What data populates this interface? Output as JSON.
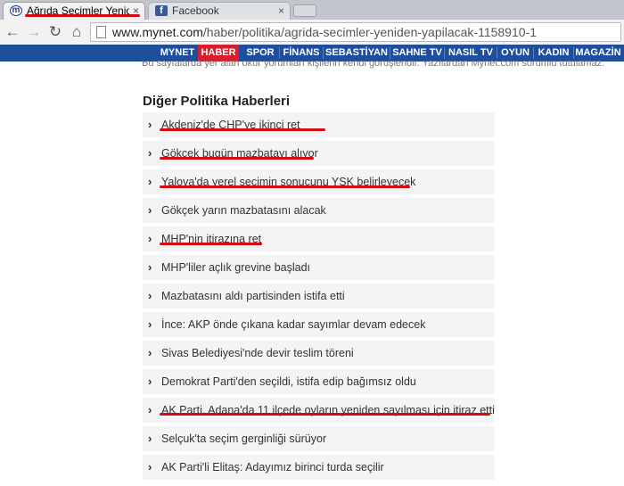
{
  "browser": {
    "tabs": [
      {
        "title": "Ağrıda Seçimler Yeniden",
        "close": "×",
        "active": true
      },
      {
        "title": "Facebook",
        "close": "×",
        "active": false
      }
    ],
    "nav": {
      "back": "←",
      "forward": "→",
      "reload": "↻",
      "home": "⌂"
    },
    "address": {
      "host": "www.mynet.com",
      "path": "/haber/politika/agrida-secimler-yeniden-yapilacak-1158910-1"
    }
  },
  "site_nav": {
    "items": [
      "MYNET",
      "HABER",
      "SPOR",
      "FİNANS",
      "SEBASTİYAN",
      "SAHNE TV",
      "NASIL TV",
      "OYUN",
      "KADIN",
      "MAGAZİN"
    ],
    "active": "HABER"
  },
  "colors": {
    "nav_bg": "#1f4f9c",
    "active_red": "#d81e2c",
    "underline_red": "#d10a14"
  },
  "article_tail": "Bu sayfalarda yer alan okur yorumları kişilerin kendi görüşleridir. Yazılardan Mynet.com sorumlu tutulamaz.",
  "section": {
    "title": "Diğer Politika Haberleri",
    "items": [
      {
        "text": "Akdeniz'de CHP'ye ikinci ret",
        "underlined": true
      },
      {
        "text": "Gökçek bugün mazbatayı alıyor",
        "underlined": true
      },
      {
        "text": "Yalova'da yerel seçimin sonucunu YSK belirleyecek",
        "underlined": true
      },
      {
        "text": "Gökçek yarın mazbatasını alacak",
        "underlined": false
      },
      {
        "text": "MHP'nin itirazına ret",
        "underlined": true
      },
      {
        "text": "MHP'liler açlık grevine başladı",
        "underlined": false
      },
      {
        "text": "Mazbatasını aldı partisinden istifa etti",
        "underlined": false
      },
      {
        "text": "İnce: AKP önde çıkana kadar sayımlar devam edecek",
        "underlined": false
      },
      {
        "text": "Sivas Belediyesi'nde devir teslim töreni",
        "underlined": false
      },
      {
        "text": "Demokrat Parti'den seçildi, istifa edip bağımsız oldu",
        "underlined": false
      },
      {
        "text": "AK Parti, Adana'da 11 ilçede oyların yeniden sayılması için itiraz etti",
        "underlined": true
      },
      {
        "text": "Selçuk'ta seçim gerginliği sürüyor",
        "underlined": false
      },
      {
        "text": "AK Parti'li Elitaş: Adayımız birinci turda seçilir",
        "underlined": false
      }
    ]
  }
}
